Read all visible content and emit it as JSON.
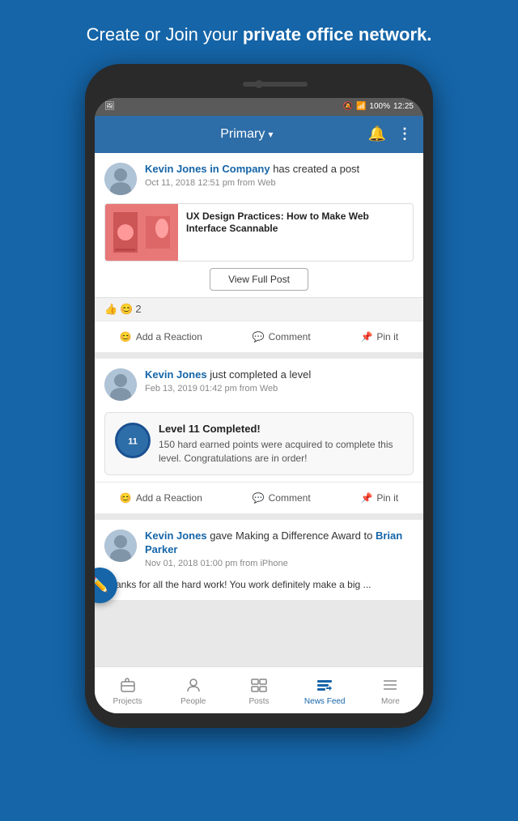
{
  "page": {
    "headline_plain": "Create or Join your ",
    "headline_bold": "private office network.",
    "status_bar": {
      "left_icon": "image-icon",
      "time": "12:25",
      "battery": "100%",
      "signal": "4G"
    },
    "app_header": {
      "title": "Primary",
      "dropdown_icon": "chevron-down",
      "bell_icon": "bell",
      "more_icon": "more-vertical"
    },
    "posts": [
      {
        "id": "post-1",
        "author": "Kevin Jones in Company",
        "action": " has created a post",
        "time": "Oct 11, 2018 12:51 pm from Web",
        "link_title": "UX Design Practices: How to Make Web Interface Scannable",
        "view_btn": "View Full Post",
        "reaction_count": "2",
        "actions": [
          "Add a Reaction",
          "Comment",
          "Pin it"
        ]
      },
      {
        "id": "post-2",
        "author": "Kevin Jones",
        "action": " just completed a level",
        "time": "Feb 13, 2019 01:42 pm from Web",
        "level_title": "Level 11 Completed!",
        "level_desc": "150 hard earned points were acquired to complete this level. Congratulations are in order!",
        "actions": [
          "Add a Reaction",
          "Comment",
          "Pin it"
        ]
      },
      {
        "id": "post-3",
        "author": "Kevin Jones",
        "action_plain": " gave Making a Difference Award to ",
        "action_bold": "Brian Parker",
        "time": "Nov 01, 2018 01:00 pm from iPhone",
        "body": "Thanks for all the hard work! You work definitely make a big ..."
      }
    ],
    "bottom_nav": [
      {
        "id": "projects",
        "icon": "briefcase",
        "label": "Projects",
        "active": false
      },
      {
        "id": "people",
        "icon": "person",
        "label": "People",
        "active": false
      },
      {
        "id": "posts",
        "icon": "posts",
        "label": "Posts",
        "active": false
      },
      {
        "id": "newsfeed",
        "icon": "newsfeed",
        "label": "News Feed",
        "active": true
      },
      {
        "id": "more",
        "icon": "menu",
        "label": "More",
        "active": false
      }
    ]
  }
}
